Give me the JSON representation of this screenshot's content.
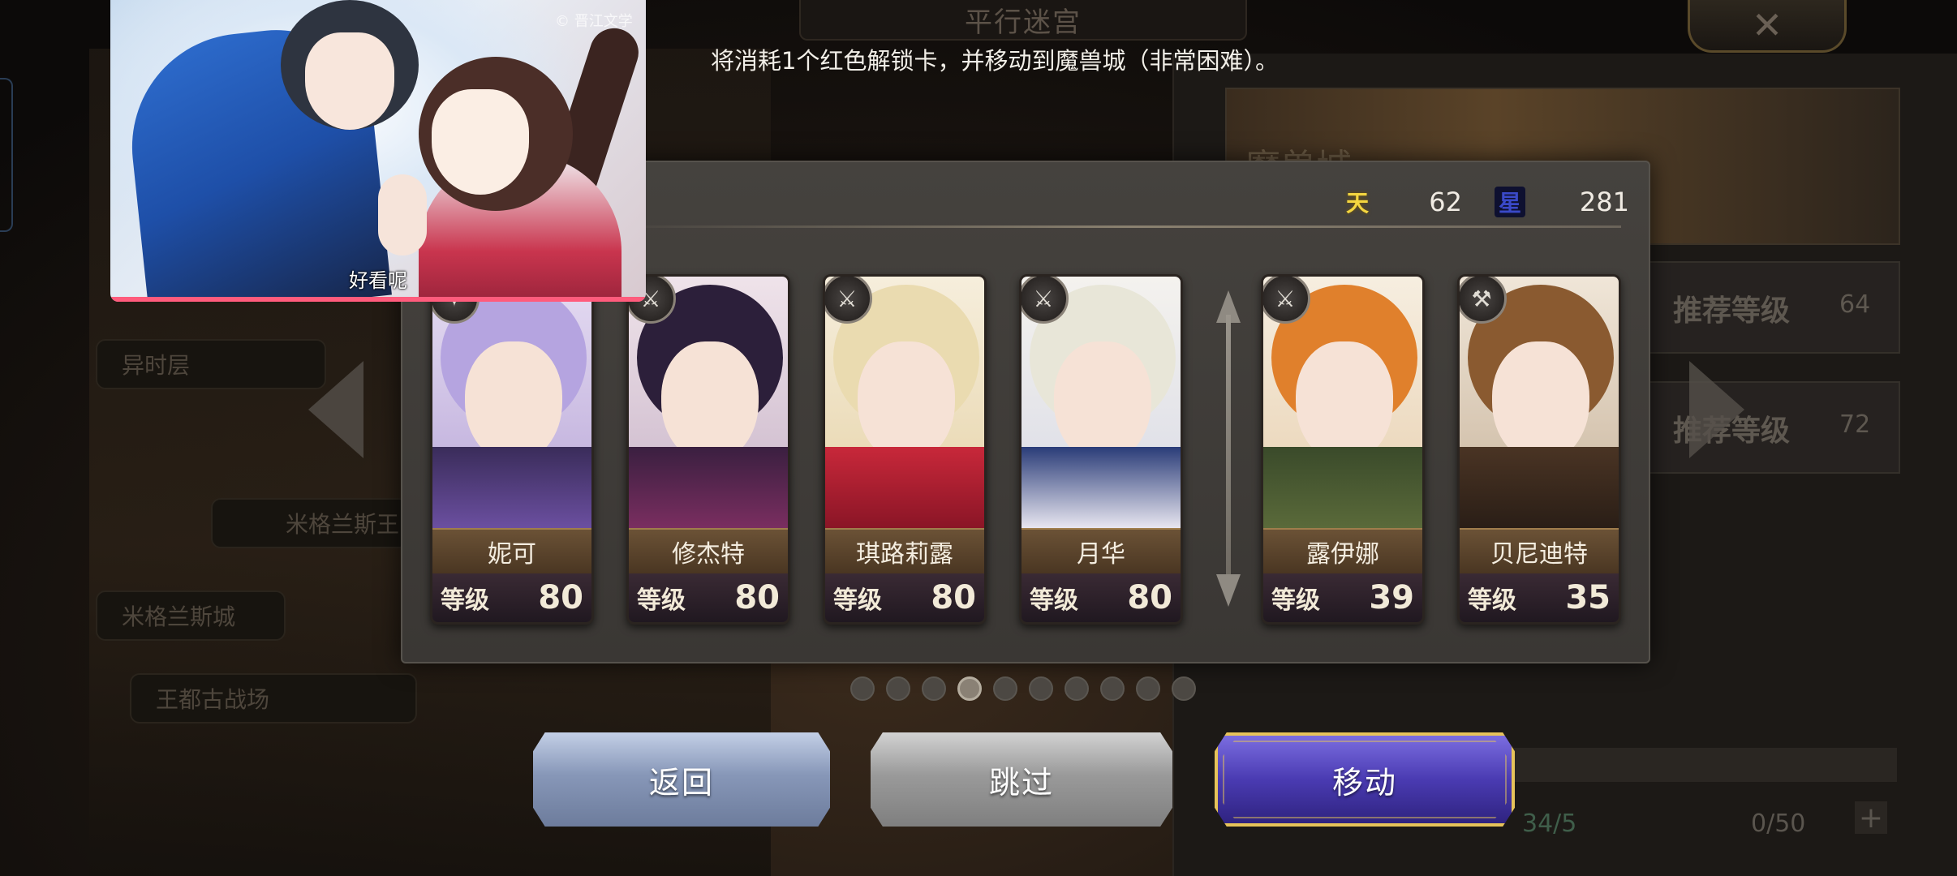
{
  "background": {
    "title": "平行迷宫",
    "close_glyph": "✕",
    "banner_title": "魔兽城",
    "recommend": [
      {
        "label": "推荐等级",
        "value": "64"
      },
      {
        "label": "推荐等级",
        "value": "72"
      }
    ],
    "map_labels": [
      "异时层",
      "米格兰斯王",
      "米格兰斯城",
      "王都古战场"
    ],
    "stats": {
      "count": "34/5",
      "cards": "0/50",
      "plus": "+"
    }
  },
  "message": "将消耗1个红色解锁卡，并移动到魔兽城（非常困难）。",
  "video": {
    "watermark": "© 晋江文学",
    "caption": "好看呢",
    "progress_fraction": 1.0
  },
  "resources": [
    {
      "icon": "天",
      "value": "62",
      "color": "#f4d640"
    },
    {
      "icon": "星",
      "value": "281",
      "color": "#3a49c8"
    }
  ],
  "party": [
    {
      "name": "妮可",
      "level_label": "等级",
      "level": "80",
      "weapon_icon": "staff-icon"
    },
    {
      "name": "修杰特",
      "level_label": "等级",
      "level": "80",
      "weapon_icon": "sword-icon"
    },
    {
      "name": "琪路莉露",
      "level_label": "等级",
      "level": "80",
      "weapon_icon": "sword-icon"
    },
    {
      "name": "月华",
      "level_label": "等级",
      "level": "80",
      "weapon_icon": "katana-icon"
    },
    {
      "name": "露伊娜",
      "level_label": "等级",
      "level": "39",
      "weapon_icon": "sword-icon"
    },
    {
      "name": "贝尼迪特",
      "level_label": "等级",
      "level": "35",
      "weapon_icon": "axe-icon"
    }
  ],
  "pagination": {
    "total": 10,
    "active_index": 3
  },
  "buttons": {
    "back": "返回",
    "skip": "跳过",
    "move": "移动"
  },
  "colors": {
    "move_button": "#4a3bb2",
    "move_border": "#e6c35a",
    "video_progress": "#ff5b7c"
  }
}
